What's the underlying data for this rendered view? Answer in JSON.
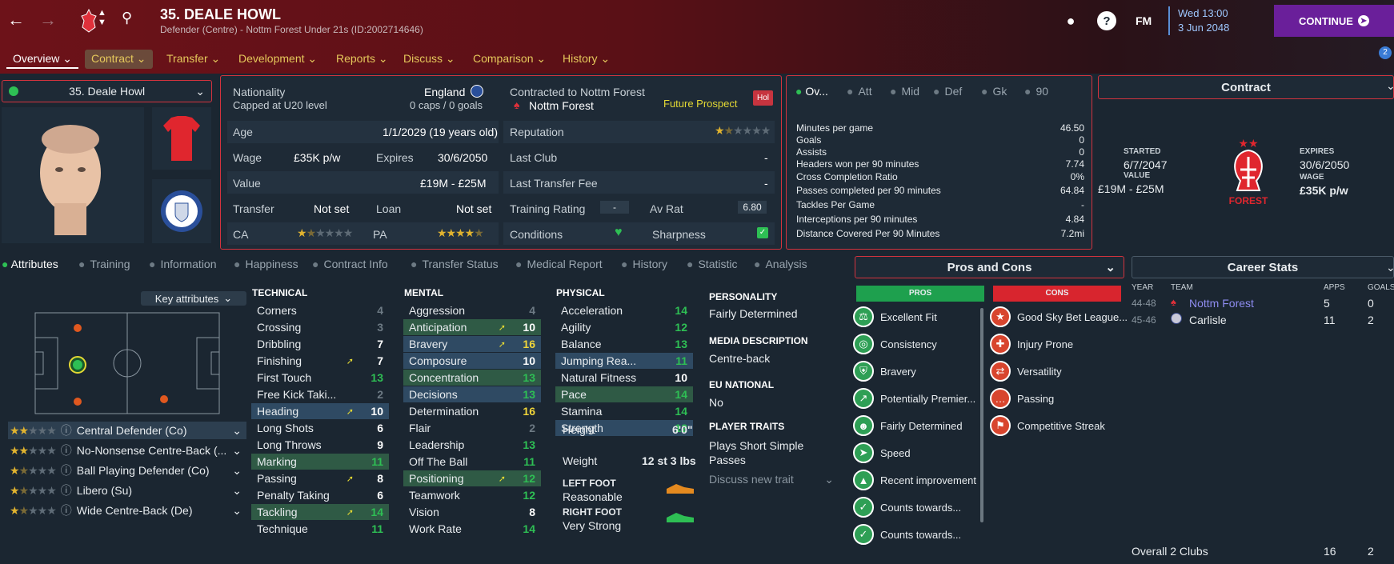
{
  "header": {
    "title": "35. DEALE HOWL",
    "subtitle": "Defender (Centre) - Nottm Forest Under 21s (ID:2002714646)",
    "date_day": "Wed 13:00",
    "date_full": "3 Jun 2048",
    "continue": "CONTINUE",
    "fm": "FM",
    "help": "?",
    "notif_count": "2"
  },
  "tabs": [
    "Overview",
    "Contract",
    "Transfer",
    "Development",
    "Reports",
    "Discuss",
    "Comparison",
    "History"
  ],
  "player_select": "35. Deale Howl",
  "info": {
    "nationality_lbl": "Nationality",
    "nationality": "England",
    "capped": "Capped at U20 level",
    "caps": "0 caps / 0 goals",
    "contracted_lbl": "Contracted to Nottm Forest",
    "club": "Nottm Forest",
    "future": "Future Prospect",
    "hol": "Hol",
    "age_lbl": "Age",
    "age": "1/1/2029 (19 years old)",
    "rep_lbl": "Reputation",
    "wage_lbl": "Wage",
    "wage": "£35K p/w",
    "expires_lbl": "Expires",
    "expires": "30/6/2050",
    "lastclub_lbl": "Last Club",
    "lastclub": "-",
    "value_lbl": "Value",
    "value": "£19M - £25M",
    "ltf_lbl": "Last Transfer Fee",
    "ltf": "-",
    "transfer_lbl": "Transfer",
    "transfer": "Not set",
    "loan_lbl": "Loan",
    "loan": "Not set",
    "tr_lbl": "Training Rating",
    "tr": "-",
    "avrat_lbl": "Av Rat",
    "avrat": "6.80",
    "ca_lbl": "CA",
    "pa_lbl": "PA",
    "cond_lbl": "Conditions",
    "sharp_lbl": "Sharpness"
  },
  "stat_tabs": [
    "Ov...",
    "Att",
    "Mid",
    "Def",
    "Gk",
    "90"
  ],
  "stats": [
    [
      "Minutes per game",
      "46.50"
    ],
    [
      "Goals",
      "0"
    ],
    [
      "Assists",
      "0"
    ],
    [
      "Headers won per 90 minutes",
      "7.74"
    ],
    [
      "Cross Completion Ratio",
      "0%"
    ],
    [
      "Passes completed per 90 minutes",
      "64.84"
    ],
    [
      "Tackles Per Game",
      "-"
    ],
    [
      "Interceptions per 90 minutes",
      "4.84"
    ],
    [
      "Distance Covered Per 90 Minutes",
      "7.2mi"
    ]
  ],
  "contract": {
    "title": "Contract",
    "started_lbl": "STARTED",
    "started": "6/7/2047",
    "value_lbl": "VALUE",
    "value": "£19M - £25M",
    "expires_lbl": "EXPIRES",
    "expires": "30/6/2050",
    "wage_lbl": "WAGE",
    "wage": "£35K p/w",
    "crest_text": "FOREST"
  },
  "bottom_tabs": [
    "Attributes",
    "Training",
    "Information",
    "Happiness",
    "Contract Info",
    "Transfer Status",
    "Medical Report",
    "History",
    "Statistic",
    "Analysis"
  ],
  "key_attr": "Key attributes",
  "roles": [
    {
      "name": "Central Defender (Co)",
      "stars": 2
    },
    {
      "name": "No-Nonsense Centre-Back (...",
      "stars": 2
    },
    {
      "name": "Ball Playing Defender (Co)",
      "stars": 1.5
    },
    {
      "name": "Libero (Su)",
      "stars": 1.5
    },
    {
      "name": "Wide Centre-Back (De)",
      "stars": 1.5
    }
  ],
  "technical_h": "TECHNICAL",
  "mental_h": "MENTAL",
  "physical_h": "PHYSICAL",
  "technical": [
    [
      "Corners",
      "4",
      "",
      ""
    ],
    [
      "Crossing",
      "3",
      "",
      ""
    ],
    [
      "Dribbling",
      "7",
      "",
      ""
    ],
    [
      "Finishing",
      "7",
      "",
      "up"
    ],
    [
      "First Touch",
      "13",
      "",
      ""
    ],
    [
      "Free Kick Taki...",
      "2",
      "",
      ""
    ],
    [
      "Heading",
      "10",
      "b",
      "up"
    ],
    [
      "Long Shots",
      "6",
      "",
      ""
    ],
    [
      "Long Throws",
      "9",
      "",
      ""
    ],
    [
      "Marking",
      "11",
      "g",
      ""
    ],
    [
      "Passing",
      "8",
      "",
      "up"
    ],
    [
      "Penalty Taking",
      "6",
      "",
      ""
    ],
    [
      "Tackling",
      "14",
      "g",
      "up"
    ],
    [
      "Technique",
      "11",
      "",
      ""
    ]
  ],
  "mental": [
    [
      "Aggression",
      "4",
      "",
      ""
    ],
    [
      "Anticipation",
      "10",
      "g",
      "up"
    ],
    [
      "Bravery",
      "16",
      "b",
      "up"
    ],
    [
      "Composure",
      "10",
      "b",
      ""
    ],
    [
      "Concentration",
      "13",
      "g",
      ""
    ],
    [
      "Decisions",
      "13",
      "b",
      ""
    ],
    [
      "Determination",
      "16",
      "",
      ""
    ],
    [
      "Flair",
      "2",
      "",
      ""
    ],
    [
      "Leadership",
      "13",
      "",
      ""
    ],
    [
      "Off The Ball",
      "11",
      "",
      ""
    ],
    [
      "Positioning",
      "12",
      "g",
      "up"
    ],
    [
      "Teamwork",
      "12",
      "",
      ""
    ],
    [
      "Vision",
      "8",
      "",
      ""
    ],
    [
      "Work Rate",
      "14",
      "",
      ""
    ]
  ],
  "physical": [
    [
      "Acceleration",
      "14",
      "",
      ""
    ],
    [
      "Agility",
      "12",
      "",
      ""
    ],
    [
      "Balance",
      "13",
      "",
      ""
    ],
    [
      "Jumping Rea...",
      "11",
      "b",
      ""
    ],
    [
      "Natural Fitness",
      "10",
      "",
      ""
    ],
    [
      "Pace",
      "14",
      "g",
      ""
    ],
    [
      "Stamina",
      "14",
      "",
      ""
    ],
    [
      "Strength",
      "12",
      "b",
      ""
    ]
  ],
  "phys_extra": {
    "height_lbl": "Height",
    "height": "6'0\"",
    "weight_lbl": "Weight",
    "weight": "12 st 3 lbs",
    "lf_lbl": "LEFT FOOT",
    "lf": "Reasonable",
    "rf_lbl": "RIGHT FOOT",
    "rf": "Very Strong"
  },
  "personality": {
    "h1": "PERSONALITY",
    "v1": "Fairly Determined",
    "h2": "MEDIA DESCRIPTION",
    "v2": "Centre-back",
    "h3": "EU NATIONAL",
    "v3": "No",
    "h4": "PLAYER TRAITS",
    "v4": "Plays Short Simple Passes",
    "v5": "Discuss new trait"
  },
  "proscons": {
    "title": "Pros and Cons",
    "pros_h": "PROS",
    "cons_h": "CONS",
    "pros": [
      "Excellent Fit",
      "Consistency",
      "Bravery",
      "Potentially Premier...",
      "Fairly Determined",
      "Speed",
      "Recent improvement",
      "Counts towards...",
      "Counts towards..."
    ],
    "cons": [
      "Good Sky Bet League...",
      "Injury Prone",
      "Versatility",
      "Passing",
      "Competitive Streak"
    ]
  },
  "career": {
    "title": "Career Stats",
    "h_year": "YEAR",
    "h_team": "TEAM",
    "h_apps": "APPS",
    "h_goals": "GOALS",
    "rows": [
      [
        "44-48",
        "Nottm Forest",
        "5",
        "0"
      ],
      [
        "45-46",
        "Carlisle",
        "11",
        "2"
      ]
    ],
    "total_lbl": "Overall 2 Clubs",
    "total_apps": "16",
    "total_goals": "2"
  }
}
